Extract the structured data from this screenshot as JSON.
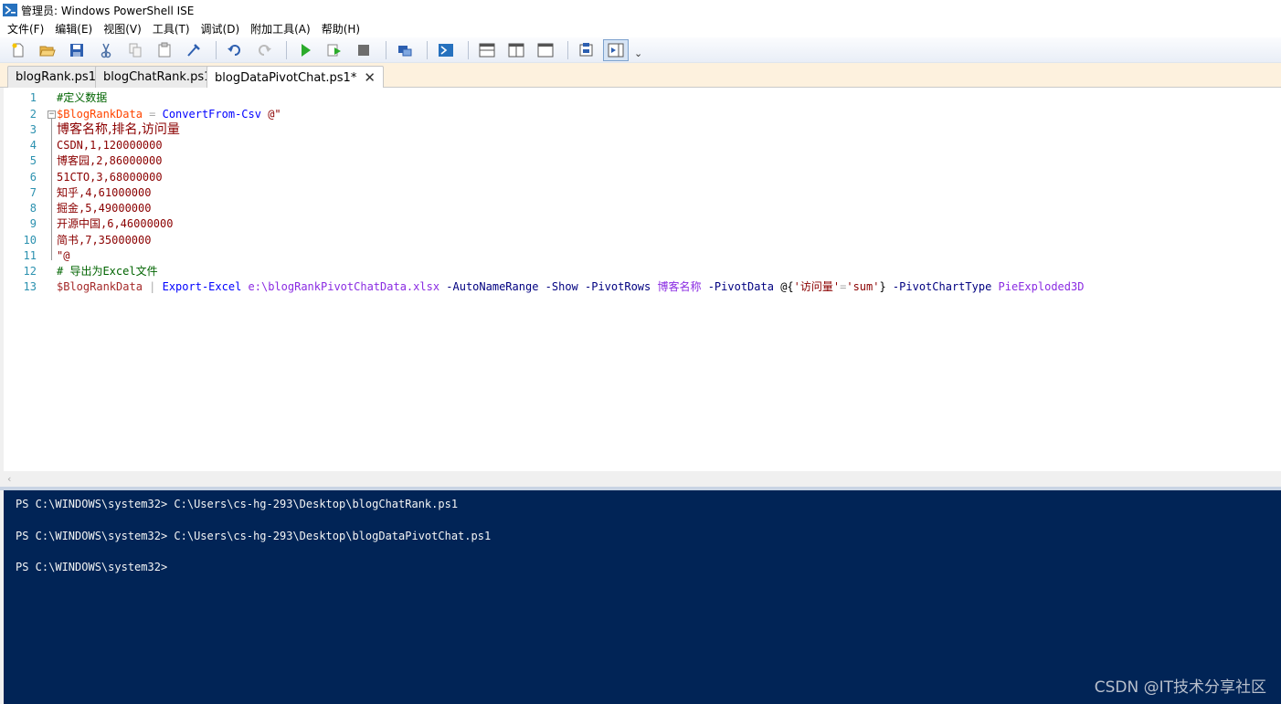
{
  "window": {
    "title": "管理员: Windows PowerShell ISE"
  },
  "menu": [
    "文件(F)",
    "编辑(E)",
    "视图(V)",
    "工具(T)",
    "调试(D)",
    "附加工具(A)",
    "帮助(H)"
  ],
  "toolbar": {
    "icons": [
      "new-file-icon",
      "open-file-icon",
      "save-icon",
      "cut-icon",
      "copy-icon",
      "paste-icon",
      "clear-icon",
      "undo-icon",
      "redo-icon",
      "run-icon",
      "run-selection-icon",
      "stop-icon",
      "remote-powershell-icon",
      "powershell-console-icon",
      "show-script-top-icon",
      "show-script-right-icon",
      "show-script-maximized-icon",
      "show-command-window-icon",
      "show-command-addon-icon"
    ],
    "more": "⌄"
  },
  "tabs": [
    {
      "label": "blogRank.ps1",
      "active": false
    },
    {
      "label": "blogChatRank.ps1",
      "active": false
    },
    {
      "label": "blogDataPivotChat.ps1*",
      "active": true
    }
  ],
  "tab_close": "✕",
  "editor": {
    "line_numbers": [
      "1",
      "2",
      "3",
      "4",
      "5",
      "6",
      "7",
      "8",
      "9",
      "10",
      "11",
      "12",
      "13"
    ],
    "fold_marker": "−",
    "lines": {
      "l1": "#定义数据",
      "l2_var": "$BlogRankData",
      "l2_op": " = ",
      "l2_cmd": "ConvertFrom-Csv",
      "l2_str": " @\"",
      "l3": "博客名称,排名,访问量",
      "l4": "CSDN,1,120000000",
      "l5": "博客园,2,86000000",
      "l6": "51CTO,3,68000000",
      "l7": "知乎,4,61000000",
      "l8": "掘金,5,49000000",
      "l9": "开源中国,6,46000000",
      "l10": "简书,7,35000000",
      "l11": "\"@",
      "l12": "# 导出为Excel文件",
      "l13_var": "$BlogRankData",
      "l13_pipe": " | ",
      "l13_cmd": "Export-Excel",
      "l13_path": " e:\\blogRankPivotChatData.xlsx",
      "l13_p1": " -AutoNameRange -Show -PivotRows",
      "l13_rows": " 博客名称",
      "l13_p2": " -PivotData",
      "l13_data_open": " @{",
      "l13_data_key": "'访问量'",
      "l13_data_eq": "=",
      "l13_data_val": "'sum'",
      "l13_data_close": "}",
      "l13_p3": " -PivotChartType",
      "l13_type": " PieExploded3D"
    }
  },
  "console": {
    "lines": [
      "PS C:\\WINDOWS\\system32> C:\\Users\\cs-hg-293\\Desktop\\blogChatRank.ps1",
      "PS C:\\WINDOWS\\system32> C:\\Users\\cs-hg-293\\Desktop\\blogDataPivotChat.ps1",
      "PS C:\\WINDOWS\\system32>"
    ]
  },
  "watermark": "CSDN @IT技术分享社区",
  "colors": {
    "console_bg": "#012456",
    "tab_strip_bg": "#fdf1de",
    "line_number": "#2b91af"
  }
}
